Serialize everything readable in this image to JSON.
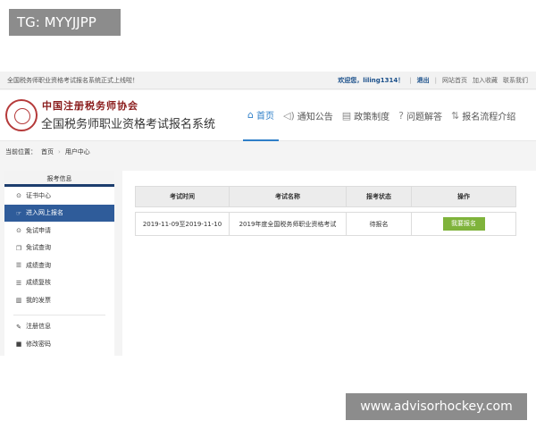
{
  "watermark_top": "TG: MYYJJPP",
  "watermark_bottom": "www.advisorhockey.com",
  "topbar": {
    "notice": "全国税务师职业资格考试报名系统正式上线啦！",
    "welcome": "欢迎您，liling1314！",
    "sep": "|",
    "logout": "退出",
    "links": [
      "网站首页",
      "加入收藏",
      "联系我们"
    ]
  },
  "header": {
    "logo_calligraphy": "中国注册税务师协会",
    "site_title": "全国税务师职业资格考试报名系统"
  },
  "nav": [
    {
      "label": "首页",
      "icon": "home-icon",
      "glyph": "⌂"
    },
    {
      "label": "通知公告",
      "icon": "speaker-icon",
      "glyph": "◁)"
    },
    {
      "label": "政策制度",
      "icon": "book-icon",
      "glyph": "▤"
    },
    {
      "label": "问题解答",
      "icon": "question-icon",
      "glyph": "?"
    },
    {
      "label": "报名流程介绍",
      "icon": "flow-icon",
      "glyph": "⇅"
    }
  ],
  "breadcrumb": {
    "label": "当前位置：",
    "home": "首页",
    "sep": "›",
    "current": "用户中心"
  },
  "sidebar": {
    "title": "报考信息",
    "items": [
      {
        "label": "证书中心",
        "icon": "clock-icon",
        "glyph": "⊙"
      },
      {
        "label": "进入网上报名",
        "icon": "pointer-icon",
        "glyph": "☞"
      },
      {
        "label": "免试申请",
        "icon": "clock-icon",
        "glyph": "⊙"
      },
      {
        "label": "免试查询",
        "icon": "copy-icon",
        "glyph": "❐"
      },
      {
        "label": "成绩查询",
        "icon": "list-icon",
        "glyph": "☰"
      },
      {
        "label": "成绩复核",
        "icon": "list-icon",
        "glyph": "☰"
      },
      {
        "label": "我的发票",
        "icon": "barcode-icon",
        "glyph": "▥"
      }
    ],
    "items2": [
      {
        "label": "注册信息",
        "icon": "wrench-icon",
        "glyph": "✎"
      },
      {
        "label": "修改密码",
        "icon": "lock-icon",
        "glyph": "■"
      }
    ]
  },
  "table": {
    "headers": [
      "考试时间",
      "考试名称",
      "报考状态",
      "操作"
    ],
    "rows": [
      {
        "time": "2019-11-09至2019-11-10",
        "name": "2019年度全国税务师职业资格考试",
        "status": "待报名",
        "action": "我要报名"
      }
    ]
  },
  "colors": {
    "nav_active": "#2f7fc8",
    "sidebar_active": "#2f5c9a",
    "signup_button": "#7fb33b",
    "sidebar_header_border": "#1c3d6e"
  }
}
